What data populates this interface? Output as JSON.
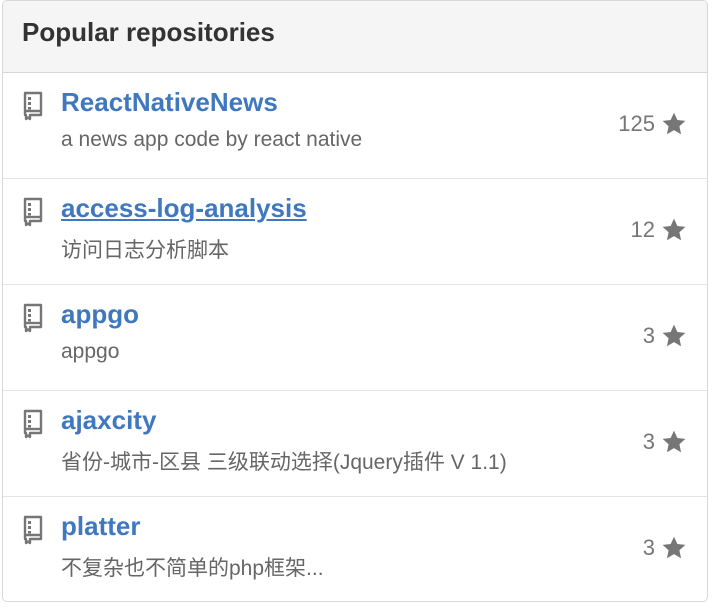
{
  "header": {
    "title": "Popular repositories"
  },
  "repos": [
    {
      "name": "ReactNativeNews",
      "description": "a news app code by react native",
      "stars": "125"
    },
    {
      "name": "access-log-analysis",
      "description": "访问日志分析脚本",
      "stars": "12"
    },
    {
      "name": "appgo",
      "description": "appgo",
      "stars": "3"
    },
    {
      "name": "ajaxcity",
      "description": "省份-城市-区县 三级联动选择(Jquery插件 V 1.1)",
      "stars": "3"
    },
    {
      "name": "platter",
      "description": "不复杂也不简单的php框架...",
      "stars": "3"
    }
  ],
  "colors": {
    "link": "#4078c0",
    "text_muted": "#666666",
    "star": "#767676",
    "header_bg": "#f5f5f5",
    "border": "#d8d8d8"
  },
  "icons": {
    "repo": "repo-book-icon",
    "star": "star-icon"
  }
}
